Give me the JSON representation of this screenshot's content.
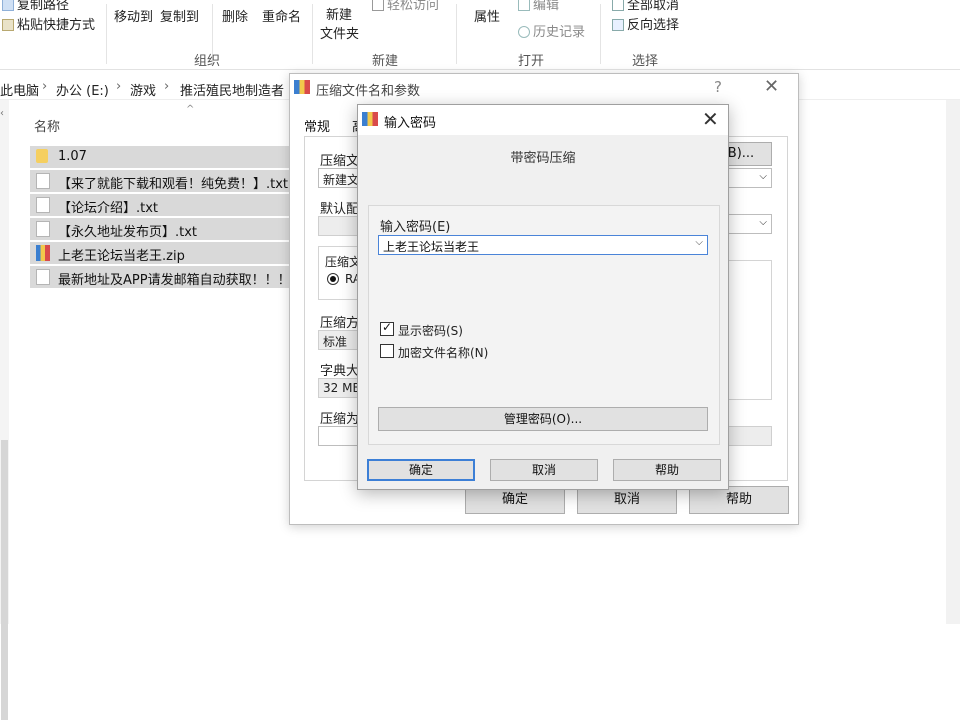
{
  "ribbon": {
    "copy_path": "复制路径",
    "paste_shortcut": "粘贴快捷方式",
    "move_to": "移动到",
    "copy_to": "复制到",
    "delete": "删除",
    "rename": "重命名",
    "new_folder_line1": "新建",
    "new_folder_line2": "文件夹",
    "easy_access": "轻松访问",
    "properties": "属性",
    "edit": "编辑",
    "history": "历史记录",
    "select_all": "全部取消",
    "invert_select": "反向选择",
    "group_organize": "组织",
    "group_new": "新建",
    "group_open": "打开",
    "group_select": "选择"
  },
  "breadcrumb": [
    "此电脑",
    "办公 (E:)",
    "游戏",
    "推活殖民地制造者"
  ],
  "file_list": {
    "column_name": "名称",
    "files": [
      {
        "name": "1.07",
        "type": "folder"
      },
      {
        "name": "【来了就能下载和观看！纯免费！】.txt",
        "type": "txt"
      },
      {
        "name": "【论坛介绍】.txt",
        "type": "txt"
      },
      {
        "name": "【永久地址发布页】.txt",
        "type": "txt"
      },
      {
        "name": "上老王论坛当老王.zip",
        "type": "zip"
      },
      {
        "name": "最新地址及APP请发邮箱自动获取！！！",
        "type": "txt"
      }
    ]
  },
  "back_dialog": {
    "title": "压缩文件名和参数",
    "help_icon": "?",
    "tab_general": "常规",
    "tab_advanced": "高",
    "label_archive_name": "压缩文",
    "archive_name_value": "新建文",
    "browse_button": "B)...",
    "label_default": "默认配",
    "label_format": "压缩文",
    "format_rar": "RA",
    "label_method": "压缩方",
    "method_value": "标准",
    "label_dict": "字典大",
    "dict_value": "32 MB",
    "label_split": "压缩为",
    "ok": "确定",
    "cancel": "取消",
    "help": "帮助"
  },
  "password_dialog": {
    "title": "输入密码",
    "subtitle": "带密码压缩",
    "label_password": "输入密码(E)",
    "password_value": "上老王论坛当老王",
    "show_password_label": "显示密码(S)",
    "show_password_checked": true,
    "encrypt_names_label": "加密文件名称(N)",
    "encrypt_names_checked": false,
    "manage_button": "管理密码(O)...",
    "ok": "确定",
    "cancel": "取消",
    "help": "帮助"
  },
  "colors": {
    "selection_gray": "#d9d9d9",
    "focus_blue": "#3c7fd6"
  }
}
